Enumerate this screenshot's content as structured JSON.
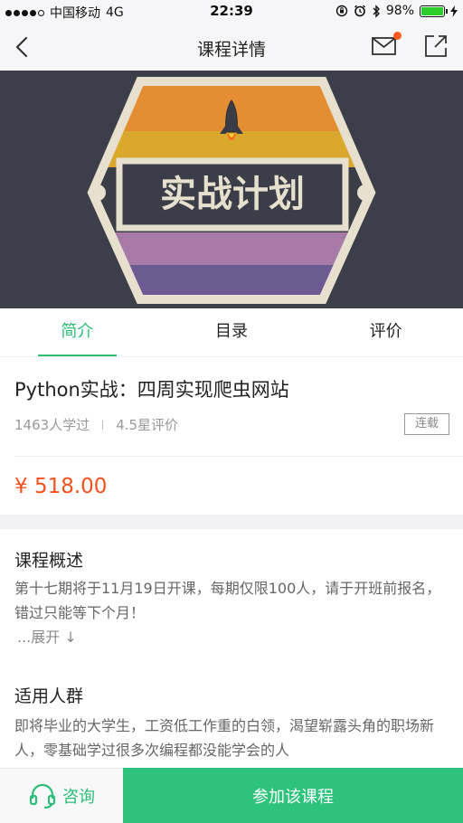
{
  "status_bar": {
    "carrier": "中国移动",
    "network": "4G",
    "time": "22:39",
    "battery": "98%",
    "battery_level": 0.98
  },
  "nav": {
    "title": "课程详情"
  },
  "hero": {
    "logo_text": "实战计划"
  },
  "tabs": [
    {
      "label": "简介",
      "active": true
    },
    {
      "label": "目录",
      "active": false
    },
    {
      "label": "评价",
      "active": false
    }
  ],
  "course": {
    "title": "Python实战：四周实现爬虫网站",
    "learners": "1463人学过",
    "rating": "4.5星评价",
    "serial_label": "连载",
    "price": "¥ 518.00"
  },
  "overview": {
    "heading": "课程概述",
    "body": "第十七期将于11月19日开课，每期仅限100人，请于开班前报名，错过只能等下个月！",
    "expand": "...展开 ↓"
  },
  "audience": {
    "heading": "适用人群",
    "body": "即将毕业的大学生，工资低工作重的白领，渴望崭露头角的职场新人，零基础学过很多次编程都没能学会的人"
  },
  "bottom_bar": {
    "consult_label": "咨询",
    "join_label": "参加该课程"
  },
  "colors": {
    "accent": "#2dbd78",
    "price": "#f4511e",
    "hero_bg": "#3c3f49"
  }
}
